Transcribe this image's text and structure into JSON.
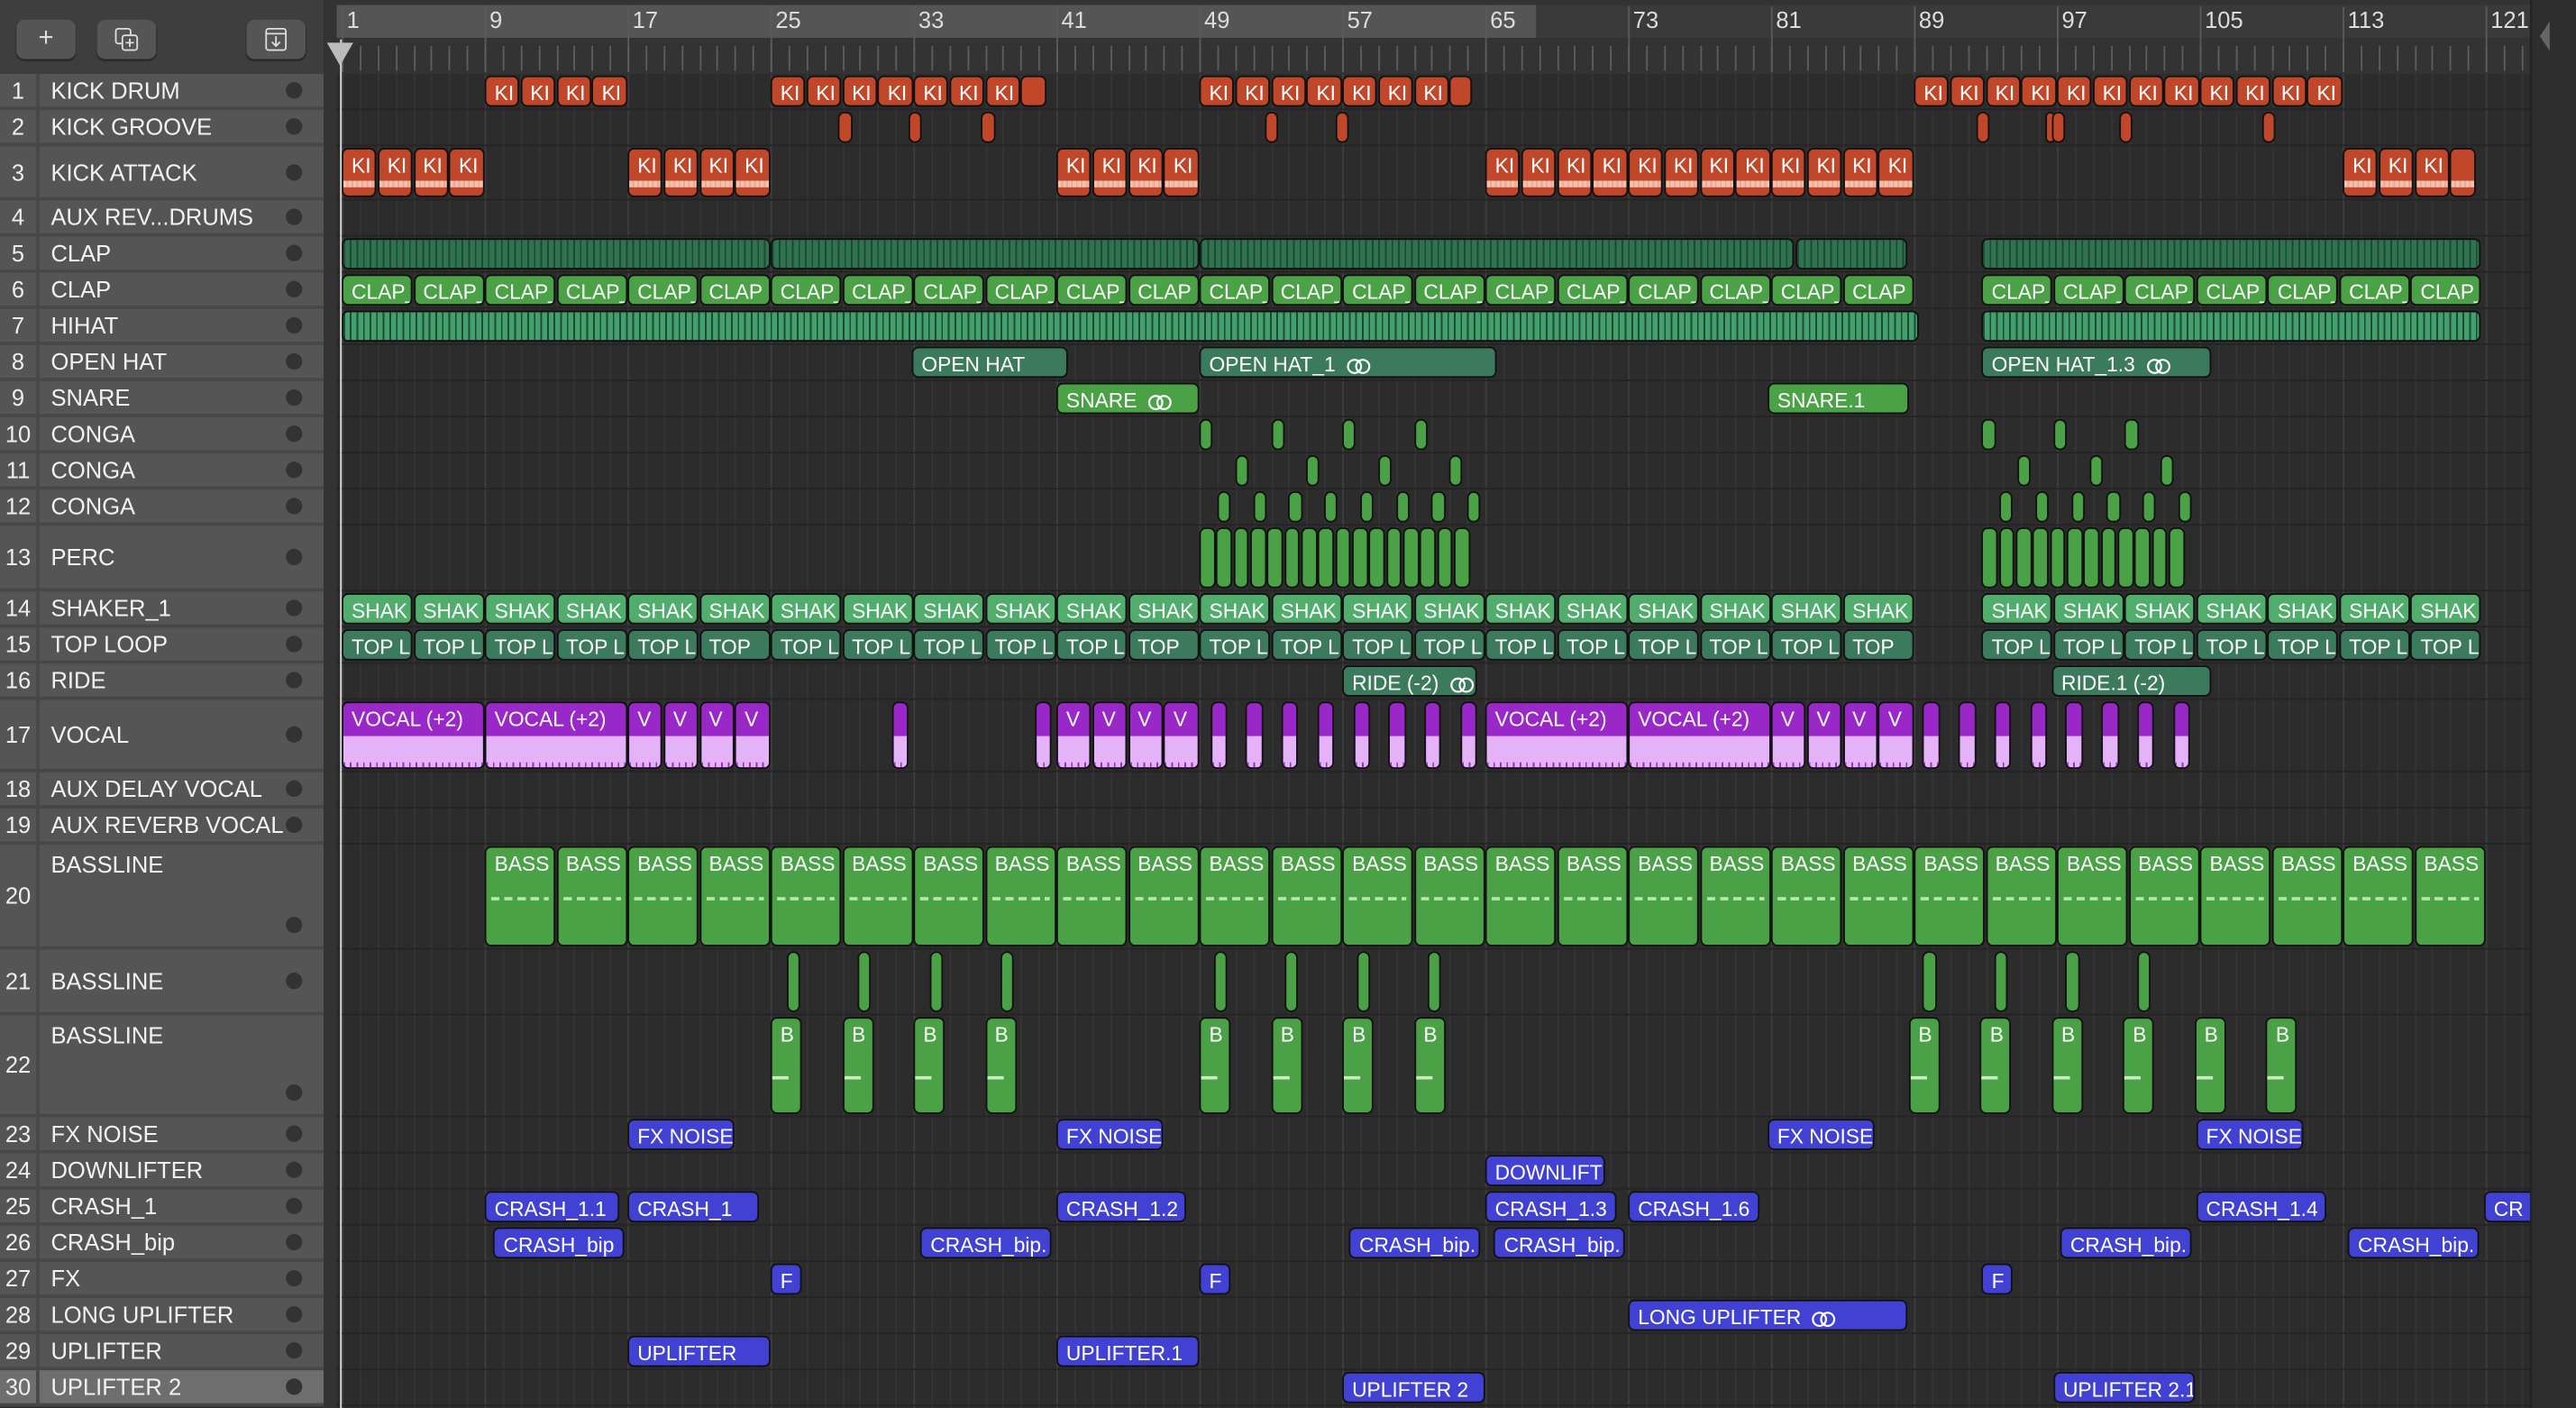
{
  "toolbar": {
    "add": "+",
    "duplicate": "duplicate-track",
    "download": "download"
  },
  "ruler": {
    "labels": [
      "1",
      "9",
      "17",
      "25",
      "33",
      "41",
      "49",
      "57",
      "65",
      "73",
      "81",
      "89",
      "97",
      "105",
      "113",
      "121"
    ]
  },
  "colors": {
    "orange": "#c0472a",
    "green": "#4aa146",
    "teal": "#3b7a5c",
    "hatchDark": "#2f7350",
    "hatchLight": "#43a06c",
    "shaker": "#50ad6c",
    "purple": "#9a28c8",
    "blue": "#4141d4",
    "header": "#555555"
  },
  "tracks": [
    {
      "num": "1",
      "name": "KICK DRUM",
      "color": "orange",
      "groups": [
        {
          "s": 9,
          "l": 2,
          "n": 4,
          "label": "KI"
        },
        {
          "s": 25,
          "l": 2,
          "n": 7,
          "label": "KI"
        },
        {
          "s": 39,
          "l": 1.5,
          "n": 1,
          "label": ""
        },
        {
          "s": 49,
          "l": 2,
          "n": 7,
          "label": "KI"
        },
        {
          "s": 63,
          "l": 1.3,
          "n": 1,
          "label": ""
        },
        {
          "s": 89,
          "l": 2,
          "n": 12,
          "label": "KI"
        }
      ]
    },
    {
      "num": "2",
      "name": "KICK GROOVE",
      "color": "orange",
      "groups": [
        {
          "s": 28.8,
          "l": 0.8,
          "n": 1,
          "label": ""
        },
        {
          "s": 32.7,
          "l": 0.8,
          "n": 1,
          "label": ""
        },
        {
          "s": 36.8,
          "l": 0.8,
          "n": 1,
          "label": ""
        },
        {
          "s": 52.7,
          "l": 0.8,
          "n": 1,
          "label": ""
        },
        {
          "s": 56.6,
          "l": 0.8,
          "n": 1,
          "label": ""
        },
        {
          "s": 92.5,
          "l": 0.8,
          "n": 1,
          "label": ""
        },
        {
          "s": 96.4,
          "l": 0.5,
          "n": 1,
          "label": ""
        },
        {
          "s": 96.7,
          "l": 0.8,
          "n": 1,
          "label": ""
        },
        {
          "s": 100.5,
          "l": 0.8,
          "n": 1,
          "label": ""
        },
        {
          "s": 108.5,
          "l": 0.8,
          "n": 1,
          "label": ""
        }
      ]
    },
    {
      "num": "3",
      "name": "KICK ATTACK",
      "color": "orange",
      "style": "wave",
      "groups": [
        {
          "s": 1,
          "l": 2,
          "n": 4,
          "label": "KI"
        },
        {
          "s": 17,
          "l": 2,
          "n": 4,
          "label": "KI"
        },
        {
          "s": 41,
          "l": 2,
          "n": 4,
          "label": "KI"
        },
        {
          "s": 65,
          "l": 2,
          "n": 12,
          "label": "KI"
        },
        {
          "s": 113,
          "l": 2,
          "n": 3,
          "label": "KI"
        },
        {
          "s": 119,
          "l": 1.5,
          "n": 1,
          "label": ""
        }
      ]
    },
    {
      "num": "4",
      "name": "AUX REV...DRUMS",
      "groups": []
    },
    {
      "num": "5",
      "name": "CLAP",
      "color": "hatchDark",
      "style": "hatch",
      "groups": [
        {
          "s": 1,
          "l": 24,
          "n": 1,
          "label": ""
        },
        {
          "s": 25,
          "l": 24,
          "n": 1,
          "label": ""
        },
        {
          "s": 49,
          "l": 33.3,
          "n": 1,
          "label": ""
        },
        {
          "s": 82.4,
          "l": 6.3,
          "n": 1,
          "label": ""
        },
        {
          "s": 92.8,
          "l": 28,
          "n": 1,
          "label": ""
        }
      ]
    },
    {
      "num": "6",
      "name": "CLAP",
      "color": "green",
      "groups": [
        {
          "s": 1,
          "l": 4,
          "n": 6,
          "label": "CLAP_",
          "last": "CLAP"
        },
        {
          "s": 25,
          "l": 4,
          "n": 6,
          "label": "CLAP_",
          "last": "CLAP"
        },
        {
          "s": 49,
          "l": 4,
          "n": 10,
          "label": "CLAP_",
          "last": "CLAP"
        },
        {
          "s": 92.8,
          "l": 4,
          "n": 7,
          "label": "CLAP_"
        }
      ]
    },
    {
      "num": "7",
      "name": "HIHAT",
      "color": "hatchLight",
      "style": "hatch",
      "groups": [
        {
          "s": 1,
          "l": 88.3,
          "n": 1,
          "label": ""
        },
        {
          "s": 92.8,
          "l": 28,
          "n": 1,
          "label": ""
        }
      ]
    },
    {
      "num": "8",
      "name": "OPEN HAT",
      "color": "teal",
      "groups": [
        {
          "s": 32.9,
          "l": 8.8,
          "n": 1,
          "label": "OPEN HAT"
        },
        {
          "s": 49,
          "l": 16.7,
          "n": 1,
          "label": "OPEN HAT_1",
          "loop": true
        },
        {
          "s": 92.8,
          "l": 12.9,
          "n": 1,
          "label": "OPEN HAT_1.3",
          "loop": true
        }
      ]
    },
    {
      "num": "9",
      "name": "SNARE",
      "color": "green",
      "groups": [
        {
          "s": 41,
          "l": 8,
          "n": 1,
          "label": "SNARE",
          "loop": true
        },
        {
          "s": 80.8,
          "l": 8,
          "n": 1,
          "label": "SNARE.1"
        }
      ]
    },
    {
      "num": "10",
      "name": "CONGA",
      "color": "green",
      "groups": [
        {
          "s": 49,
          "l": 0.8,
          "n": 4,
          "step": 4,
          "label": ""
        },
        {
          "s": 92.8,
          "l": 0.8,
          "n": 3,
          "step": 4,
          "label": ""
        }
      ]
    },
    {
      "num": "11",
      "name": "CONGA",
      "color": "green",
      "groups": [
        {
          "s": 51,
          "l": 0.8,
          "n": 4,
          "step": 4,
          "label": ""
        },
        {
          "s": 94.8,
          "l": 0.8,
          "n": 3,
          "step": 4,
          "label": ""
        }
      ]
    },
    {
      "num": "12",
      "name": "CONGA",
      "color": "green",
      "groups": [
        {
          "s": 50,
          "l": 0.8,
          "n": 8,
          "step": 2,
          "label": ""
        },
        {
          "s": 93.8,
          "l": 0.8,
          "n": 6,
          "step": 2,
          "label": ""
        }
      ]
    },
    {
      "num": "13",
      "name": "PERC",
      "color": "green",
      "groups": [
        {
          "s": 49,
          "l": 0.95,
          "n": 16,
          "label": ""
        },
        {
          "s": 92.8,
          "l": 0.95,
          "n": 12,
          "label": ""
        }
      ]
    },
    {
      "num": "14",
      "name": "SHAKER_1",
      "color": "shaker",
      "groups": [
        {
          "s": 1,
          "l": 4,
          "n": 22,
          "label": "SHAK"
        },
        {
          "s": 92.8,
          "l": 4,
          "n": 7,
          "label": "SHAK"
        }
      ]
    },
    {
      "num": "15",
      "name": "TOP LOOP",
      "color": "teal",
      "groups": [
        {
          "s": 1,
          "l": 4,
          "n": 6,
          "label": "TOP L",
          "last": "TOP"
        },
        {
          "s": 25,
          "l": 4,
          "n": 6,
          "label": "TOP L",
          "last": "TOP"
        },
        {
          "s": 49,
          "l": 4,
          "n": 10,
          "label": "TOP L",
          "last": "TOP"
        },
        {
          "s": 92.8,
          "l": 4,
          "n": 7,
          "label": "TOP L"
        }
      ]
    },
    {
      "num": "16",
      "name": "RIDE",
      "color": "teal",
      "groups": [
        {
          "s": 57,
          "l": 7.6,
          "n": 1,
          "label": "RIDE (-2)",
          "loop": true
        },
        {
          "s": 96.7,
          "l": 9,
          "n": 1,
          "label": "RIDE.1 (-2)"
        }
      ]
    },
    {
      "num": "17",
      "name": "VOCAL",
      "color": "purple",
      "style": "vocal",
      "groups": [
        {
          "s": 1,
          "l": 8,
          "n": 2,
          "label": "VOCAL (+2)"
        },
        {
          "s": 17,
          "l": 2,
          "n": 4,
          "label": "V"
        },
        {
          "s": 31.8,
          "l": 1,
          "n": 1,
          "label": ""
        },
        {
          "s": 39.8,
          "l": 1,
          "n": 1,
          "label": ""
        },
        {
          "s": 41,
          "l": 2,
          "n": 4,
          "label": "V"
        },
        {
          "s": 49.6,
          "l": 1,
          "n": 8,
          "step": 2,
          "label": ""
        },
        {
          "s": 65,
          "l": 8,
          "n": 2,
          "label": "VOCAL (+2)"
        },
        {
          "s": 81,
          "l": 2,
          "n": 4,
          "label": "V"
        },
        {
          "s": 89.5,
          "l": 1,
          "n": 8,
          "step": 2,
          "label": ""
        }
      ]
    },
    {
      "num": "18",
      "name": "AUX DELAY VOCAL",
      "groups": []
    },
    {
      "num": "19",
      "name": "AUX REVERB VOCAL",
      "groups": []
    },
    {
      "num": "20",
      "name": "BASSLINE",
      "color": "green",
      "style": "bass",
      "split": true,
      "groups": [
        {
          "s": 9,
          "l": 4,
          "n": 28,
          "label": "BASS"
        }
      ]
    },
    {
      "num": "21",
      "name": "BASSLINE",
      "color": "green",
      "style": "thin",
      "groups": [
        {
          "s": 25.9,
          "l": 0.8,
          "n": 4,
          "step": 4,
          "label": ""
        },
        {
          "s": 49.8,
          "l": 0.8,
          "n": 4,
          "step": 4,
          "label": ""
        },
        {
          "s": 89.5,
          "l": 0.8,
          "n": 4,
          "step": 4,
          "label": ""
        }
      ]
    },
    {
      "num": "22",
      "name": "BASSLINE",
      "color": "green",
      "style": "b",
      "split": true,
      "groups": [
        {
          "s": 25,
          "l": 1.8,
          "n": 4,
          "step": 4,
          "label": "B"
        },
        {
          "s": 49,
          "l": 1.8,
          "n": 4,
          "step": 4,
          "label": "B"
        },
        {
          "s": 88.7,
          "l": 1.8,
          "n": 6,
          "step": 4,
          "label": "B"
        }
      ]
    },
    {
      "num": "23",
      "name": "FX NOISE",
      "color": "blue",
      "groups": [
        {
          "s": 17,
          "l": 6,
          "n": 1,
          "label": "FX NOISE"
        },
        {
          "s": 41,
          "l": 6,
          "n": 1,
          "label": "FX NOISE."
        },
        {
          "s": 80.8,
          "l": 6,
          "n": 1,
          "label": "FX NOISE."
        },
        {
          "s": 104.8,
          "l": 6,
          "n": 1,
          "label": "FX NOISE."
        }
      ]
    },
    {
      "num": "24",
      "name": "DOWNLIFTER",
      "color": "blue",
      "groups": [
        {
          "s": 65,
          "l": 6.8,
          "n": 1,
          "label": "DOWNLIFT"
        }
      ]
    },
    {
      "num": "25",
      "name": "CRASH_1",
      "color": "blue",
      "groups": [
        {
          "s": 9,
          "l": 7.6,
          "n": 1,
          "label": "CRASH_1.1"
        },
        {
          "s": 17,
          "l": 7.4,
          "n": 1,
          "label": "CRASH_1"
        },
        {
          "s": 41,
          "l": 7.3,
          "n": 1,
          "label": "CRASH_1.2"
        },
        {
          "s": 65,
          "l": 7.4,
          "n": 1,
          "label": "CRASH_1.3"
        },
        {
          "s": 73,
          "l": 7.4,
          "n": 1,
          "label": "CRASH_1.6"
        },
        {
          "s": 104.8,
          "l": 7.3,
          "n": 1,
          "label": "CRASH_1.4"
        },
        {
          "s": 120.9,
          "l": 3,
          "n": 1,
          "label": "CR"
        }
      ]
    },
    {
      "num": "26",
      "name": "CRASH_bip",
      "color": "blue",
      "groups": [
        {
          "s": 9.5,
          "l": 7.4,
          "n": 1,
          "label": "CRASH_bip"
        },
        {
          "s": 33.4,
          "l": 7.4,
          "n": 1,
          "label": "CRASH_bip."
        },
        {
          "s": 57.4,
          "l": 7.4,
          "n": 1,
          "label": "CRASH_bip."
        },
        {
          "s": 65.5,
          "l": 7.4,
          "n": 1,
          "label": "CRASH_bip."
        },
        {
          "s": 97.2,
          "l": 7.4,
          "n": 1,
          "label": "CRASH_bip."
        },
        {
          "s": 113.3,
          "l": 7.4,
          "n": 1,
          "label": "CRASH_bip."
        }
      ]
    },
    {
      "num": "27",
      "name": "FX",
      "color": "blue",
      "groups": [
        {
          "s": 25,
          "l": 1.8,
          "n": 1,
          "label": "F"
        },
        {
          "s": 49,
          "l": 1.8,
          "n": 1,
          "label": "F"
        },
        {
          "s": 92.8,
          "l": 1.8,
          "n": 1,
          "label": "F"
        }
      ]
    },
    {
      "num": "28",
      "name": "LONG UPLIFTER",
      "color": "blue",
      "groups": [
        {
          "s": 73,
          "l": 15.7,
          "n": 1,
          "label": "LONG UPLIFTER",
          "loop": true
        }
      ]
    },
    {
      "num": "29",
      "name": "UPLIFTER",
      "color": "blue",
      "groups": [
        {
          "s": 17,
          "l": 8,
          "n": 1,
          "label": "UPLIFTER"
        },
        {
          "s": 41,
          "l": 8,
          "n": 1,
          "label": "UPLIFTER.1"
        }
      ]
    },
    {
      "num": "30",
      "name": "UPLIFTER 2",
      "color": "blue",
      "selected": true,
      "groups": [
        {
          "s": 57,
          "l": 8,
          "n": 1,
          "label": "UPLIFTER 2"
        },
        {
          "s": 96.8,
          "l": 8,
          "n": 1,
          "label": "UPLIFTER 2.1"
        }
      ]
    }
  ]
}
